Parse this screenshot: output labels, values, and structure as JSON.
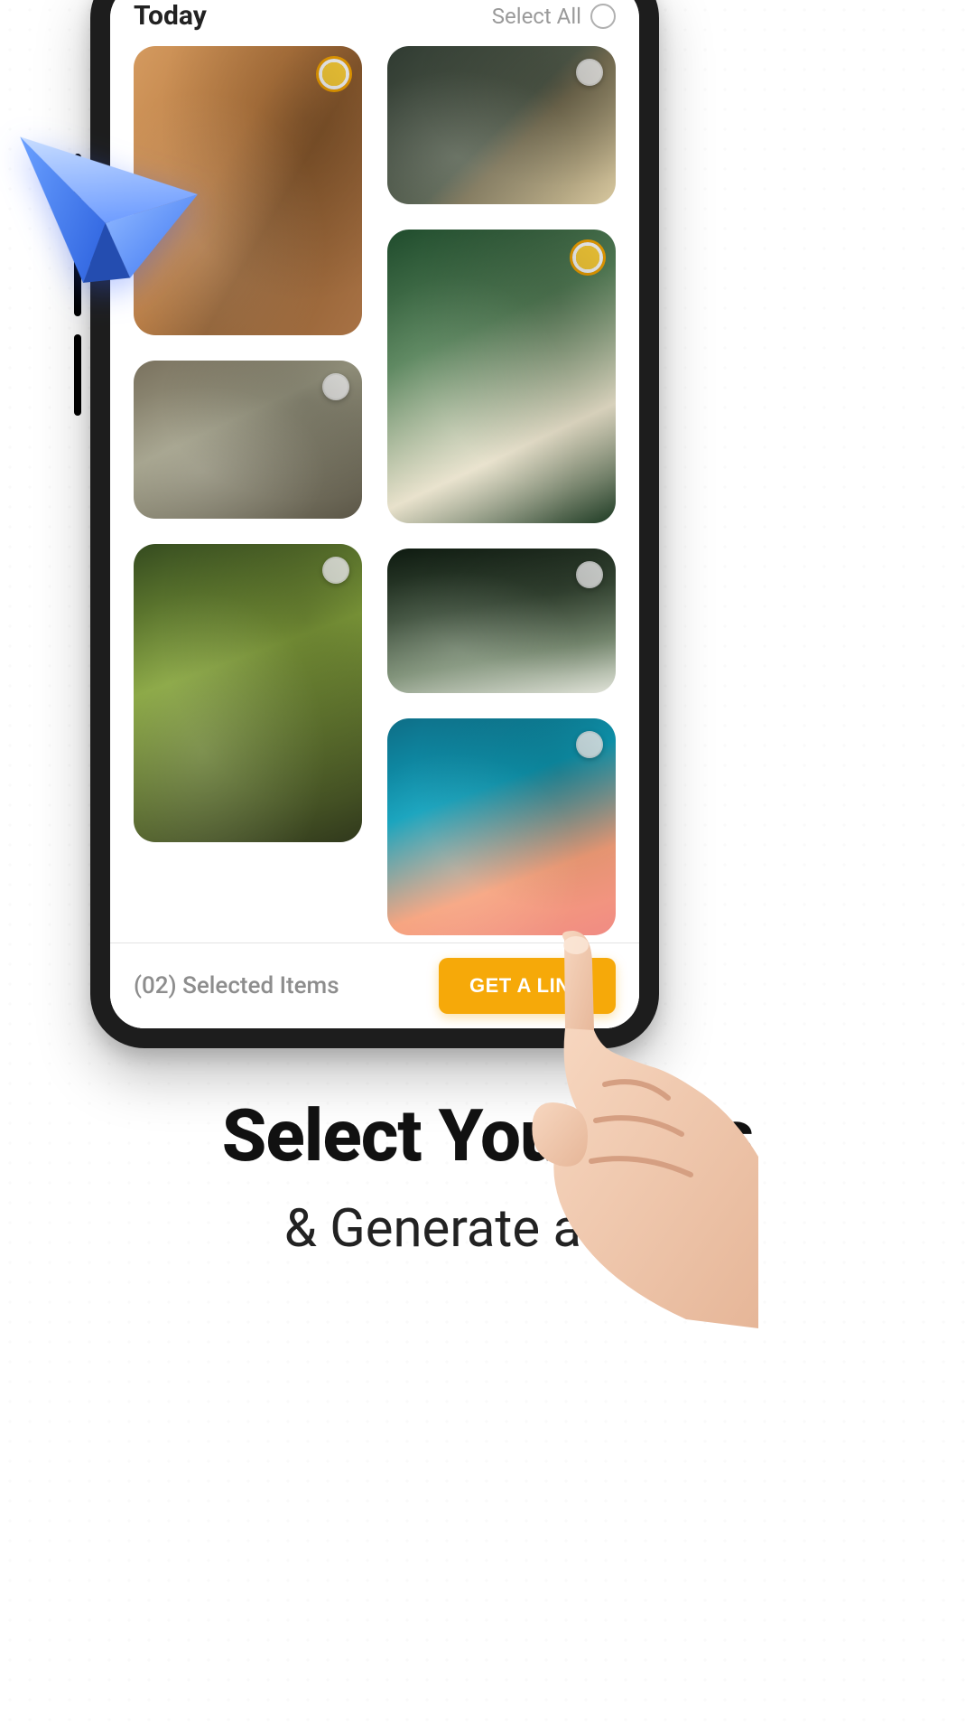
{
  "header": {
    "title": "Today",
    "select_all_label": "Select All"
  },
  "gallery": {
    "columns": [
      [
        {
          "id": "photo-1",
          "desc": "person-standing",
          "selected": true,
          "height_class": "t1"
        },
        {
          "id": "photo-2",
          "desc": "mountain-landscape",
          "selected": false,
          "height_class": "t2"
        },
        {
          "id": "photo-3",
          "desc": "portrait-in-foliage",
          "selected": false,
          "height_class": "t3"
        }
      ],
      [
        {
          "id": "photo-4",
          "desc": "food-flatlay",
          "selected": false,
          "height_class": "t4"
        },
        {
          "id": "photo-5",
          "desc": "couple-photo",
          "selected": true,
          "height_class": "t5"
        },
        {
          "id": "photo-6",
          "desc": "car-in-forest",
          "selected": false,
          "height_class": "t6"
        },
        {
          "id": "photo-7",
          "desc": "sky-tower",
          "selected": false,
          "height_class": "t7"
        }
      ]
    ]
  },
  "footer": {
    "selected_text": "(02) Selected Items",
    "cta_label": "GET A LINK"
  },
  "promo": {
    "title": "Select Your Files",
    "subtitle": "& Generate a Link"
  },
  "colors": {
    "accent": "#f6a909",
    "plane": "#4d8cff"
  }
}
